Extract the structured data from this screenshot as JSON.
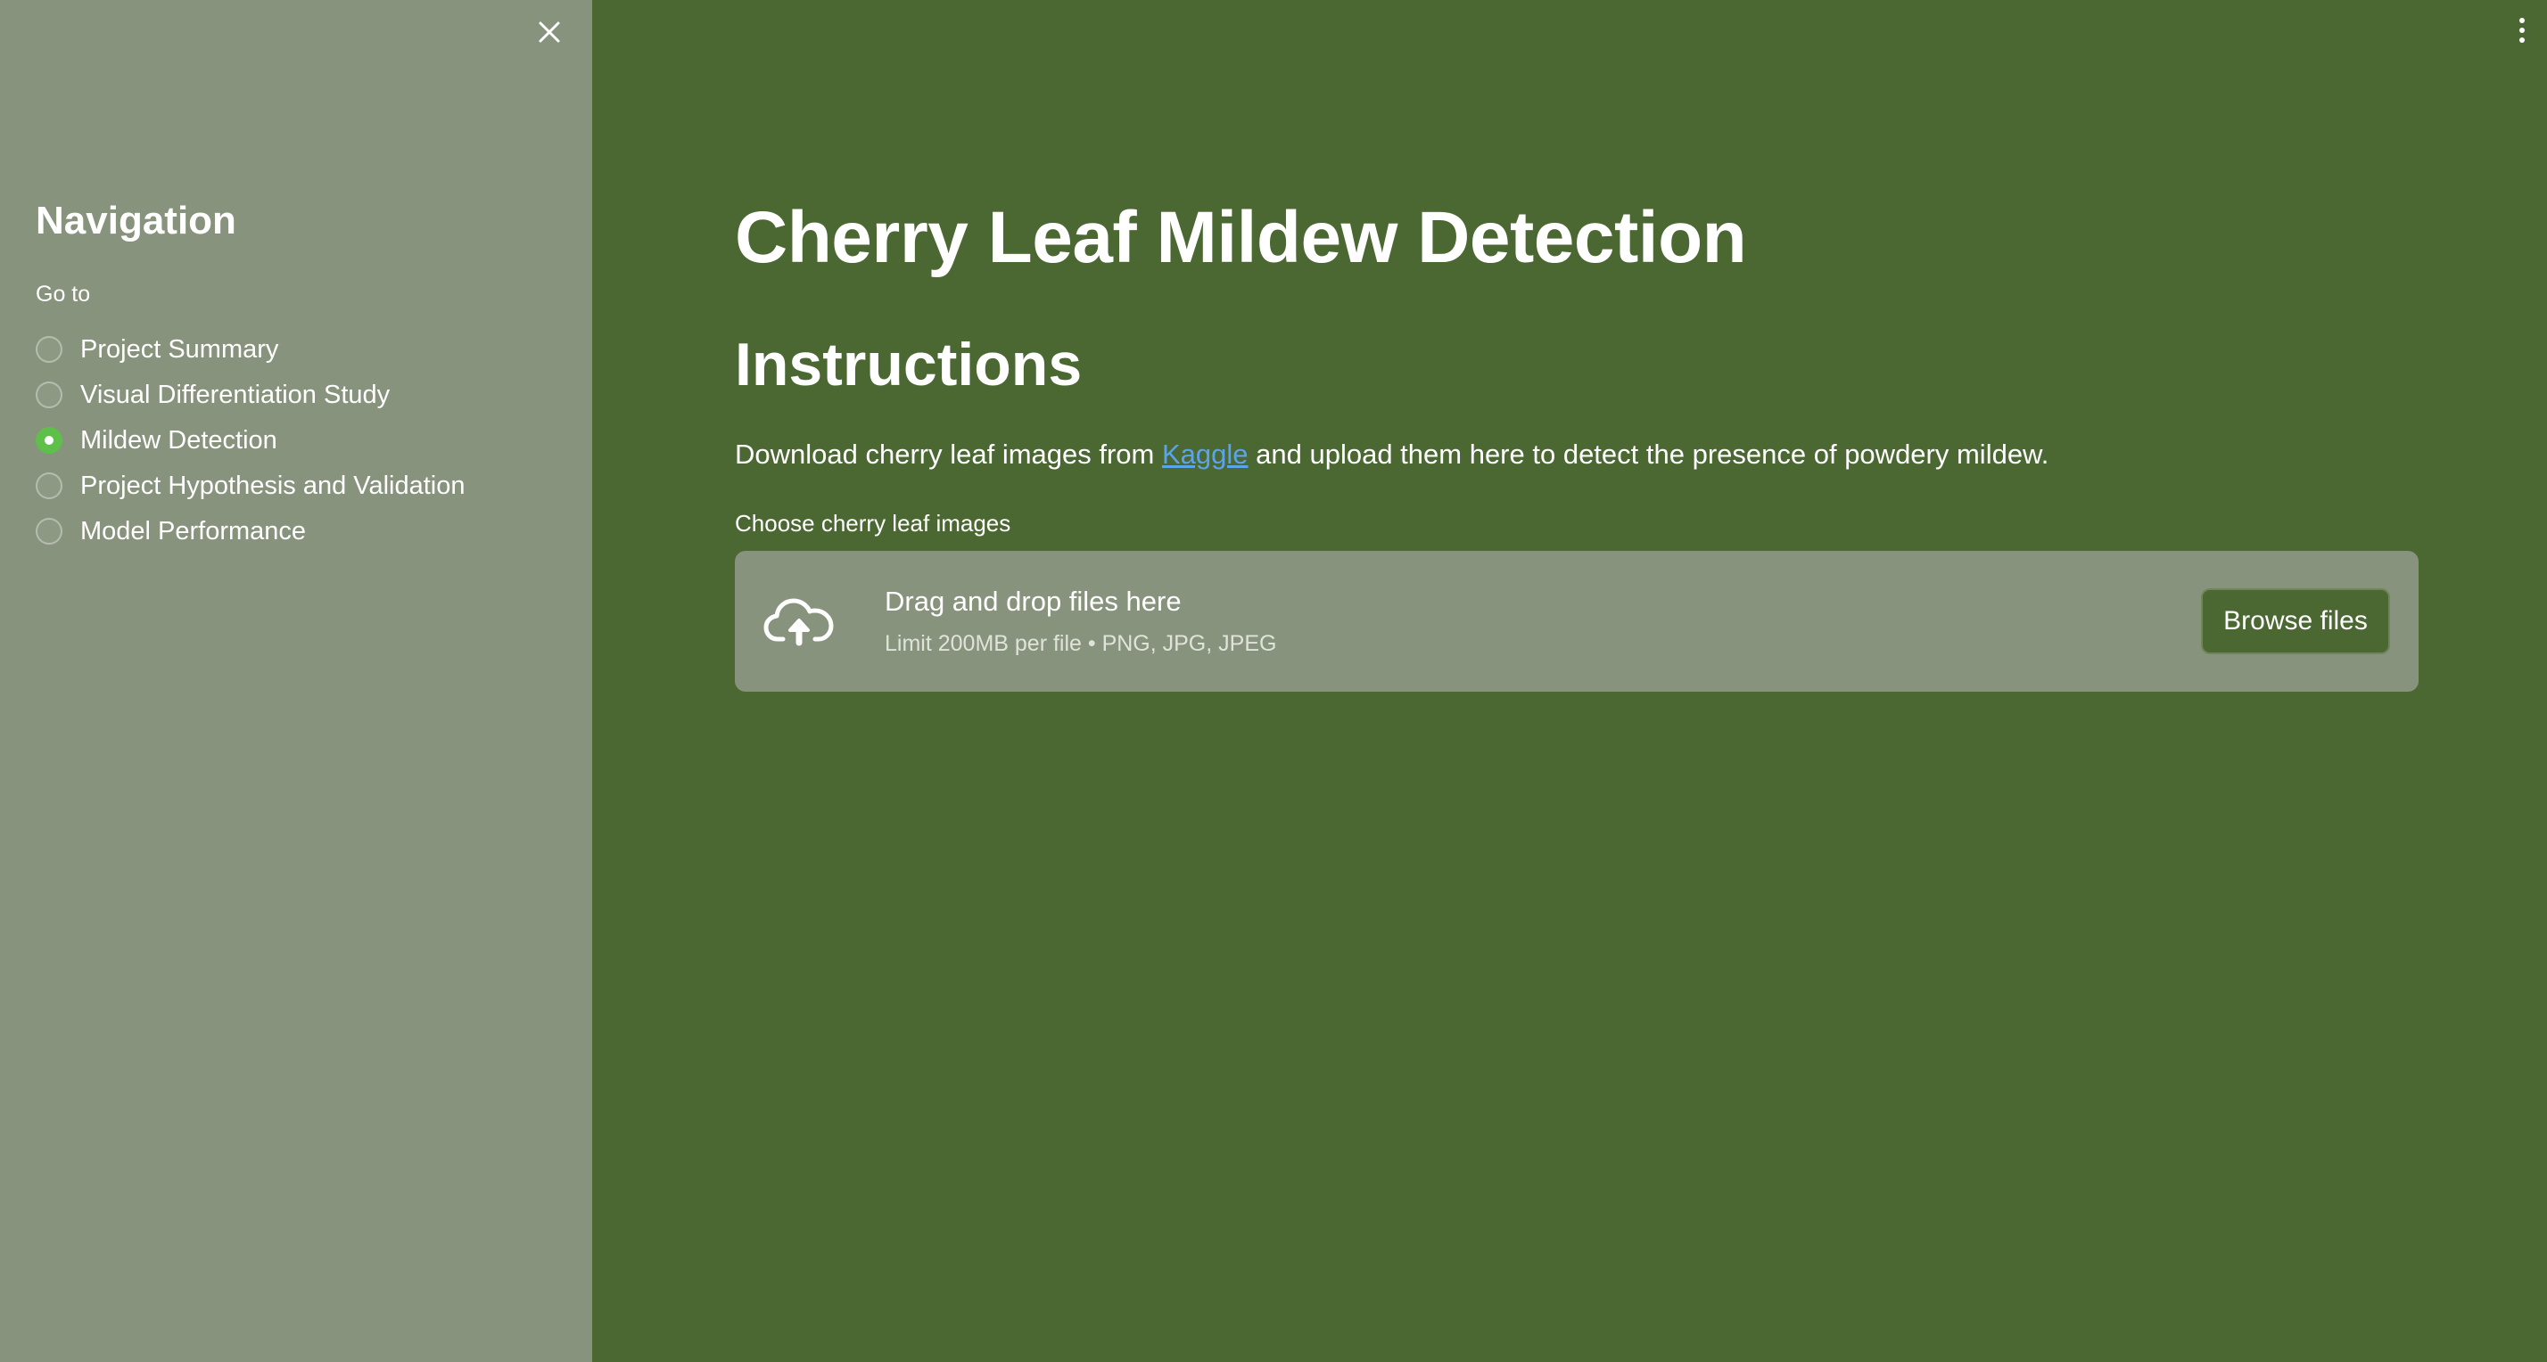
{
  "sidebar": {
    "title": "Navigation",
    "goto_label": "Go to",
    "items": [
      {
        "label": "Project Summary",
        "selected": false
      },
      {
        "label": "Visual Differentiation Study",
        "selected": false
      },
      {
        "label": "Mildew Detection",
        "selected": true
      },
      {
        "label": "Project Hypothesis and Validation",
        "selected": false
      },
      {
        "label": "Model Performance",
        "selected": false
      }
    ],
    "close_icon": "close-icon"
  },
  "main": {
    "title": "Cherry Leaf Mildew Detection",
    "section_title": "Instructions",
    "instructions": {
      "before": "Download cherry leaf images from ",
      "link_text": "Kaggle",
      "after": " and upload them here to detect the presence of powdery mildew."
    },
    "uploader": {
      "label": "Choose cherry leaf images",
      "drop_title": "Drag and drop files here",
      "drop_subtitle": "Limit 200MB per file • PNG, JPG, JPEG",
      "browse_label": "Browse files",
      "icon": "cloud-upload-icon"
    },
    "menu_icon": "more-vertical-icon"
  },
  "colors": {
    "sidebar_bg": "#87937c",
    "main_bg": "#4b6833",
    "accent": "#5ec04a",
    "link": "#5aa4ec"
  }
}
